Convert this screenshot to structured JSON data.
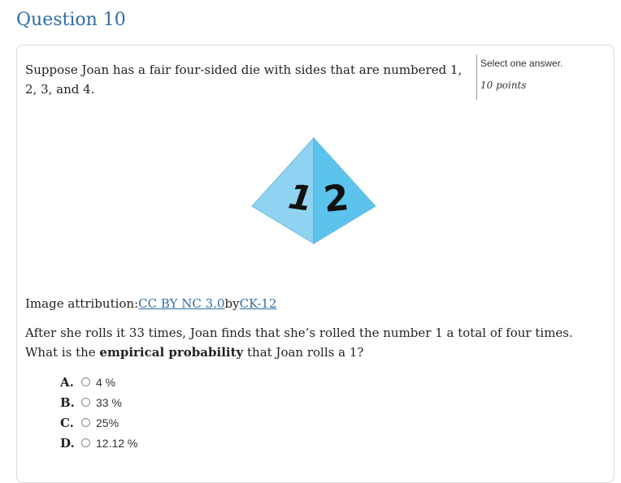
{
  "question": {
    "title": "Question 10",
    "status": "Select one answer.",
    "points": "10 points",
    "stem_part1": "Suppose Joan has a fair four-sided die with sides that are numbered 1, 2, 3, and 4.",
    "figure_labels": [
      "1",
      "2"
    ],
    "attribution": {
      "prefix": "Image attribution:",
      "license_link": "CC BY NC 3.0",
      "by": "by",
      "author_link": "CK-12"
    },
    "stem_part2_before": "After she rolls it 33 times, Joan finds that she’s rolled the number 1 a total of four times. What is the ",
    "stem_part2_bold": "empirical probability",
    "stem_part2_after": " that Joan rolls a 1?",
    "answers": [
      {
        "letter": "A.",
        "text": "4 %"
      },
      {
        "letter": "B.",
        "text": "33 %"
      },
      {
        "letter": "C.",
        "text": "25%"
      },
      {
        "letter": "D.",
        "text": "12.12 %"
      }
    ]
  },
  "colors": {
    "title": "#2e6da4",
    "link": "#2e6da4",
    "die_left_face": "#8fd3f0",
    "die_right_face": "#5cc3ec"
  }
}
